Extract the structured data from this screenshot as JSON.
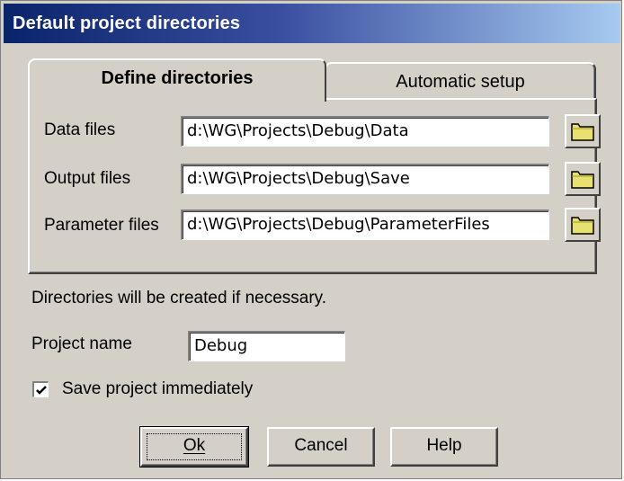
{
  "window": {
    "title": "Default project directories"
  },
  "tabs": [
    {
      "label": "Define directories",
      "active": true
    },
    {
      "label": "Automatic setup",
      "active": false
    }
  ],
  "directories": [
    {
      "label": "Data files",
      "value": "d:\\WG\\Projects\\Debug\\Data"
    },
    {
      "label": "Output files",
      "value": "d:\\WG\\Projects\\Debug\\Save"
    },
    {
      "label": "Parameter files",
      "value": "d:\\WG\\Projects\\Debug\\ParameterFiles"
    }
  ],
  "folder_icon": "folder-icon",
  "note": "Directories will be created if necessary.",
  "project": {
    "label": "Project name",
    "value": "Debug"
  },
  "save_option": {
    "label": "Save project immediately",
    "checked": true
  },
  "buttons": {
    "ok": "Ok",
    "cancel": "Cancel",
    "help": "Help"
  },
  "colors": {
    "face": "#d4d0c8",
    "title_start": "#0a246a",
    "title_end": "#a6caf0",
    "folder_fill": "#e8e070"
  }
}
